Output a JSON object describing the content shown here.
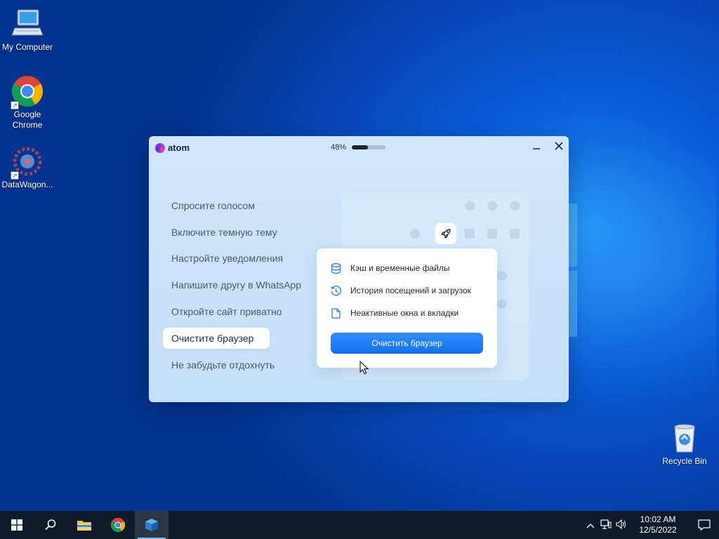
{
  "desktop": {
    "icons": [
      {
        "label": "My Computer",
        "icon": "computer-icon"
      },
      {
        "label": "Google Chrome",
        "icon": "chrome-icon"
      },
      {
        "label": "DataWagon...",
        "icon": "datawagon-icon"
      },
      {
        "label": "Recycle Bin",
        "icon": "recycle-bin-icon"
      }
    ]
  },
  "app": {
    "logo": "atom",
    "progress": {
      "text": "48%",
      "value": 0.48
    },
    "tips": [
      "Спросите голосом",
      "Включите темную тему",
      "Настройте уведомления",
      "Напишите другу в WhatsApp",
      "Откройте сайт приватно",
      "Очистите браузер",
      "Не забудьте отдохнуть"
    ],
    "active_tip_index": 5,
    "card": {
      "items": [
        {
          "label": "Кэш и временные файлы",
          "icon": "database-icon"
        },
        {
          "label": "История посещений и загрузок",
          "icon": "history-icon"
        },
        {
          "label": "Неактивные окна и вкладки",
          "icon": "page-icon"
        }
      ],
      "button": "Очистить браузер"
    },
    "accent": "#1f7df5"
  },
  "taskbar": {
    "clock_time": "10:02 AM",
    "clock_date": "12/5/2022",
    "buttons": [
      "start",
      "search",
      "file-explorer",
      "chrome",
      "atom-installer"
    ]
  }
}
